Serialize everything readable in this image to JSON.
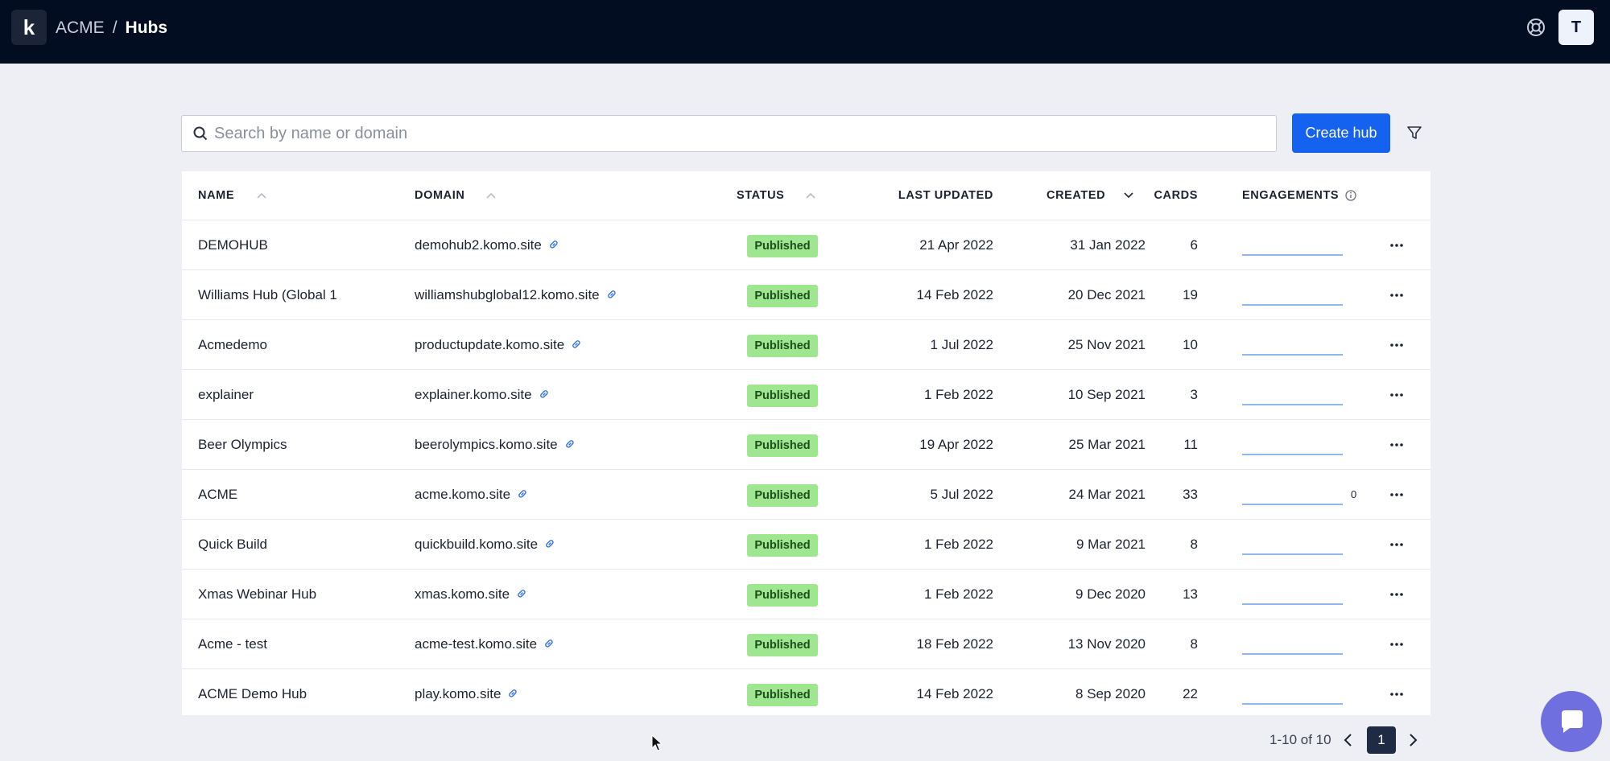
{
  "header": {
    "logo_letter": "k",
    "breadcrumb": {
      "org": "ACME",
      "separator": "/",
      "current": "Hubs"
    },
    "avatar_initial": "T",
    "help_icon": "lifebuoy-icon"
  },
  "toolbar": {
    "search_placeholder": "Search by name or domain",
    "create_label": "Create hub",
    "filter_icon": "filter-icon"
  },
  "table": {
    "columns": [
      "NAME",
      "DOMAIN",
      "STATUS",
      "LAST UPDATED",
      "CREATED",
      "CARDS",
      "ENGAGEMENTS"
    ],
    "rows": [
      {
        "name": "DEMOHUB",
        "domain": "demohub2.komo.site",
        "status": "Published",
        "updated": "21 Apr 2022",
        "created": "31 Jan 2022",
        "cards": "6",
        "engagements": ""
      },
      {
        "name": "Williams Hub (Global 1",
        "domain": "williamshubglobal12.komo.site",
        "status": "Published",
        "updated": "14 Feb 2022",
        "created": "20 Dec 2021",
        "cards": "19",
        "engagements": ""
      },
      {
        "name": "Acmedemo",
        "domain": "productupdate.komo.site",
        "status": "Published",
        "updated": "1 Jul 2022",
        "created": "25 Nov 2021",
        "cards": "10",
        "engagements": ""
      },
      {
        "name": "explainer",
        "domain": "explainer.komo.site",
        "status": "Published",
        "updated": "1 Feb 2022",
        "created": "10 Sep 2021",
        "cards": "3",
        "engagements": ""
      },
      {
        "name": "Beer Olympics",
        "domain": "beerolympics.komo.site",
        "status": "Published",
        "updated": "19 Apr 2022",
        "created": "25 Mar 2021",
        "cards": "11",
        "engagements": ""
      },
      {
        "name": "ACME",
        "domain": "acme.komo.site",
        "status": "Published",
        "updated": "5 Jul 2022",
        "created": "24 Mar 2021",
        "cards": "33",
        "engagements": "0"
      },
      {
        "name": "Quick Build",
        "domain": "quickbuild.komo.site",
        "status": "Published",
        "updated": "1 Feb 2022",
        "created": "9 Mar 2021",
        "cards": "8",
        "engagements": ""
      },
      {
        "name": "Xmas Webinar Hub",
        "domain": "xmas.komo.site",
        "status": "Published",
        "updated": "1 Feb 2022",
        "created": "9 Dec 2020",
        "cards": "13",
        "engagements": ""
      },
      {
        "name": "Acme - test",
        "domain": "acme-test.komo.site",
        "status": "Published",
        "updated": "18 Feb 2022",
        "created": "13 Nov 2020",
        "cards": "8",
        "engagements": ""
      },
      {
        "name": "ACME Demo Hub",
        "domain": "play.komo.site",
        "status": "Published",
        "updated": "14 Feb 2022",
        "created": "8 Sep 2020",
        "cards": "22",
        "engagements": ""
      }
    ]
  },
  "pagination": {
    "range": "1-10 of 10",
    "current_page": "1"
  },
  "colors": {
    "topbar": "#030d22",
    "accent": "#1662f0",
    "published_badge": "#9ee68f",
    "chat_button": "#6f6fe0"
  }
}
